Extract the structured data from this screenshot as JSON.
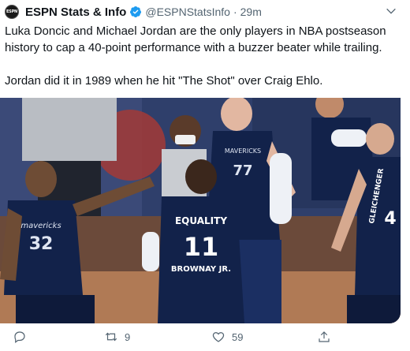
{
  "tweet": {
    "author_name": "ESPN Stats & Info",
    "avatar_text": "ESPN",
    "handle": "@ESPNStatsInfo",
    "separator": "·",
    "time": "29m",
    "text_1": "Luka Doncic and Michael Jordan are the only players in NBA postseason history to cap a 40-point performance with a buzzer beater while trailing.",
    "text_2": "Jordan did it in 1989 when he hit \"The Shot\" over Craig Ehlo."
  },
  "media": {
    "jersey_left": "mavericks",
    "jersey_left_number": "32",
    "jersey_center": "EQUALITY",
    "jersey_center_number": "11",
    "jersey_center_name": "BROWNAY JR.",
    "jersey_top": "MAVERICKS",
    "jersey_top_number": "77",
    "jersey_right_name": "GLEICHENGER",
    "jersey_right_number": "4"
  },
  "actions": {
    "reply_count": "",
    "retweet_count": "9",
    "like_count": "59",
    "share_count": ""
  },
  "colors": {
    "verified": "#1d9bf0",
    "secondary_text": "#536471",
    "jersey_navy": "#12224a"
  }
}
